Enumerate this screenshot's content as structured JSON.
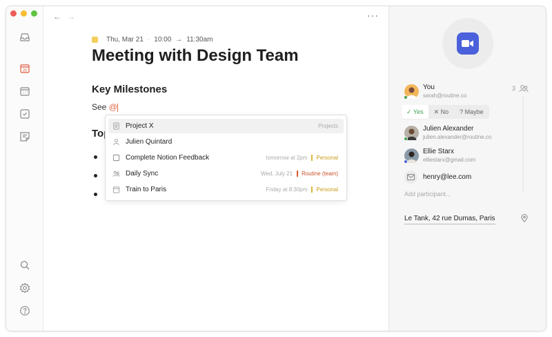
{
  "event": {
    "date": "Thu, Mar 21",
    "start": "10:00",
    "arrow": "→",
    "end": "11:30am",
    "title": "Meeting with Design Team",
    "sections": [
      "Key Milestones",
      "Top"
    ],
    "mention_prefix": "See ",
    "mention_trigger": "@",
    "color": "#f3cf5a"
  },
  "sidebar": {
    "calendar_day": "20",
    "icons": [
      "inbox-icon",
      "calendar-today-icon",
      "calendar-grid-icon",
      "task-check-icon",
      "notes-icon",
      "search-icon",
      "settings-icon",
      "help-icon"
    ]
  },
  "toolbar": {
    "back": "←",
    "forward": "→",
    "more": "···"
  },
  "mention_popup": {
    "items": [
      {
        "label": "Project X",
        "meta": "Projects",
        "icon": "document-icon",
        "selected": true
      },
      {
        "label": "Julien Quintard",
        "meta": "",
        "icon": "person-icon",
        "selected": false
      },
      {
        "label": "Complete Notion Feedback",
        "meta": "tomorrow at 2pm",
        "tag": "Personal",
        "tag_color": "#e0b63a",
        "icon": "checkbox-icon",
        "selected": false
      },
      {
        "label": "Daily Sync",
        "meta": "Wed, July 21",
        "tag": "Routine (team)",
        "tag_color": "#d9582f",
        "icon": "people-icon",
        "selected": false
      },
      {
        "label": "Train to Paris",
        "meta": "Friday at 8:30pm",
        "tag": "Personal",
        "tag_color": "#e0b63a",
        "icon": "calendar-icon",
        "selected": false
      }
    ]
  },
  "right_panel": {
    "conference": "zoom-video-icon",
    "conference_color": "#4a61db",
    "organizer": {
      "name": "You",
      "email": "sarah@routine.co"
    },
    "participant_count": "3",
    "rsvp": {
      "yes": "Yes",
      "no": "No",
      "maybe": "Maybe",
      "selected": "yes"
    },
    "participants": [
      {
        "name": "Julien Alexander",
        "email": "julien.alexander@routine.co"
      },
      {
        "name": "Ellie Starx",
        "email": "elliestarx@gmail.com"
      }
    ],
    "invited_email": "henry@lee.com",
    "add_placeholder": "Add participant...",
    "location": "Le Tank, 42 rue Dumas, Paris"
  }
}
